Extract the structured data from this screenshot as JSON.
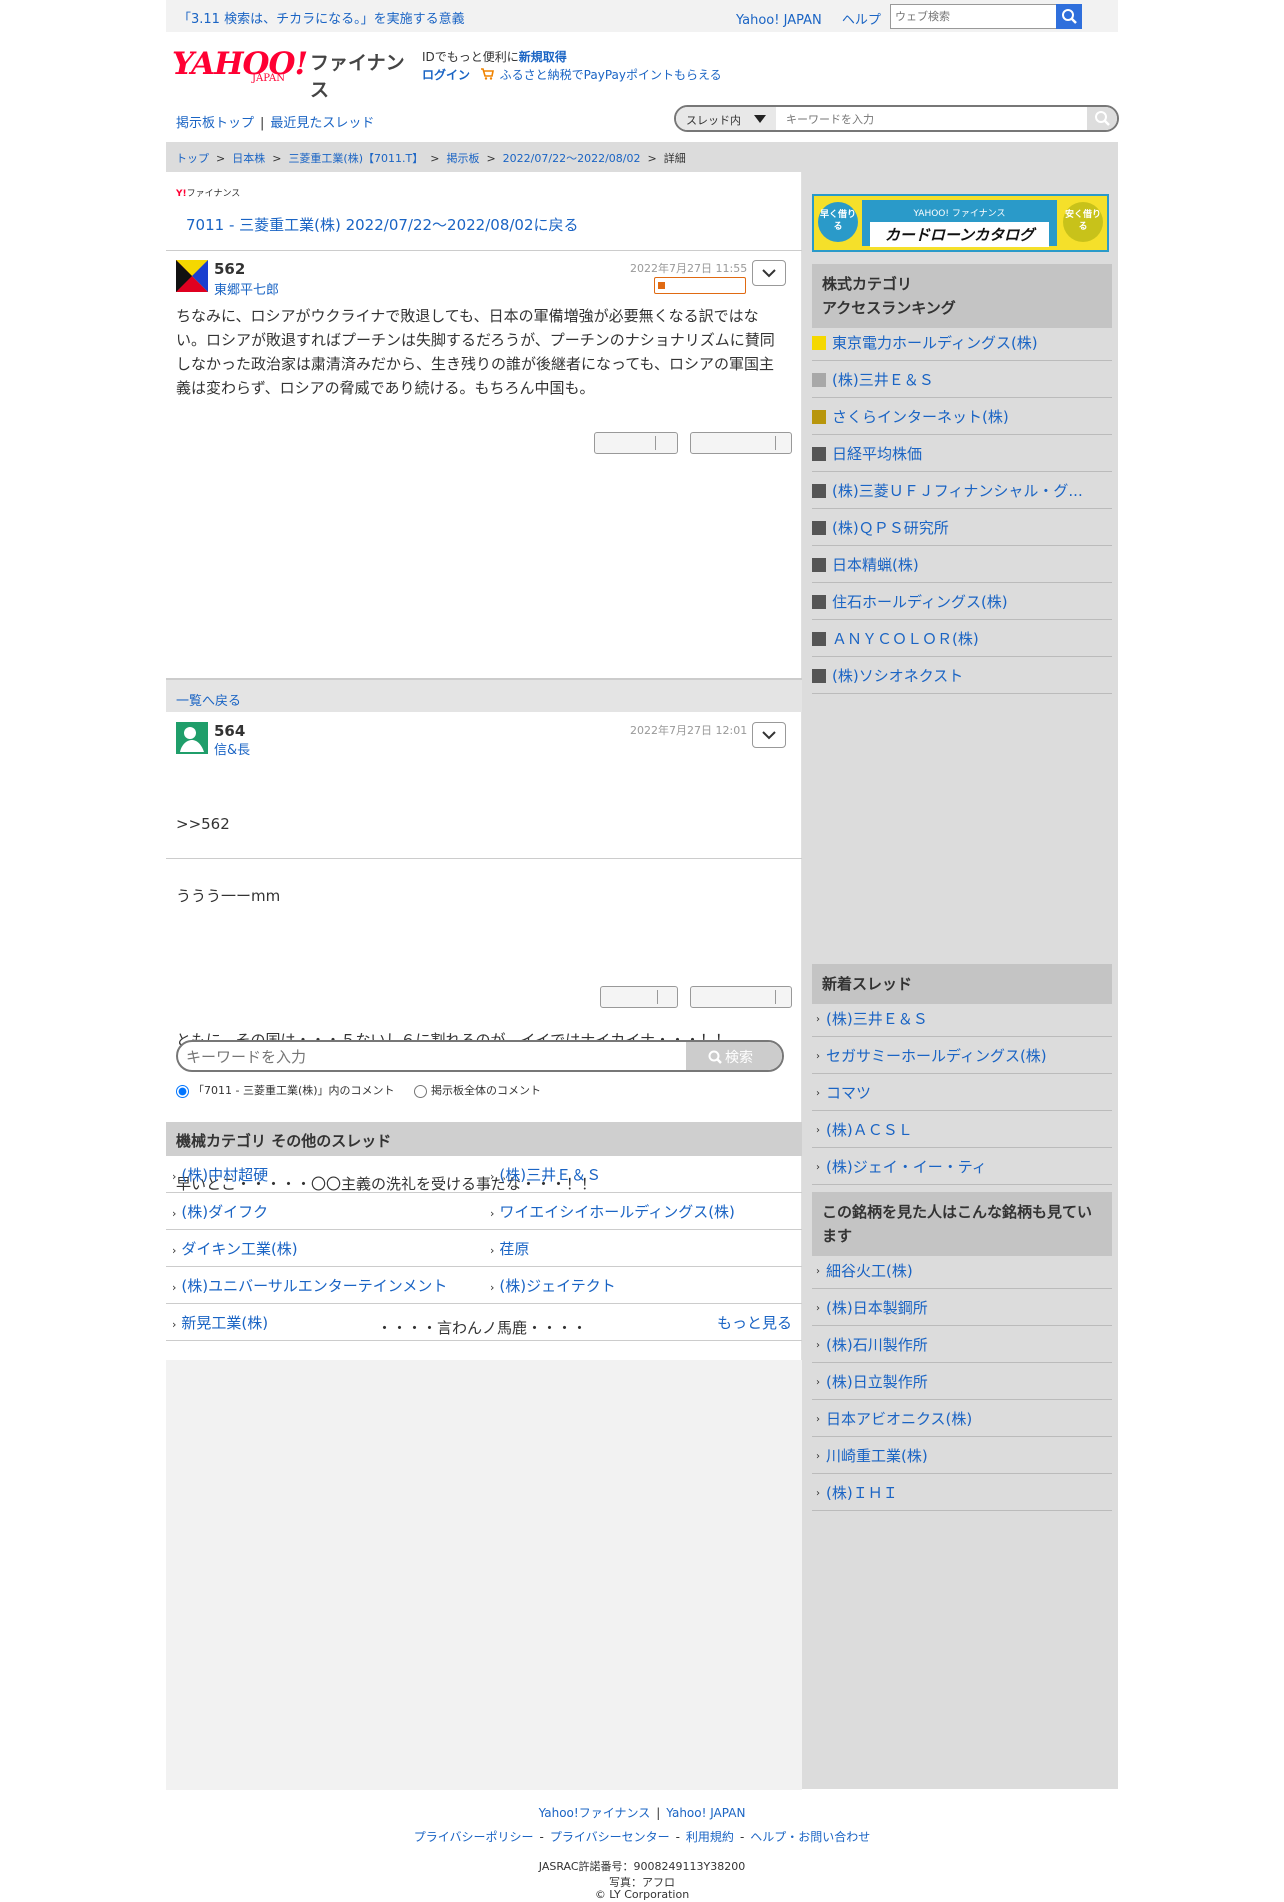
{
  "topbar": {
    "notice": "「3.11 検索は、チカラになる。」を実施する意義",
    "links": [
      "Yahoo! JAPAN",
      "ヘルプ"
    ],
    "search_placeholder": "ウェブ検索"
  },
  "header": {
    "logo_main": "YAHOO!",
    "logo_sub": "JAPAN",
    "logo_service": "ファイナンス",
    "id_line_prefix": "IDでもっと便利に",
    "id_line_link": "新規取得",
    "login": "ログイン",
    "furusato": "ふるさと納税でPayPayポイントもらえる"
  },
  "subnav": {
    "items": [
      "掲示板トップ",
      "最近見たスレッド"
    ],
    "sep": "|",
    "scope": "スレッド内",
    "search_placeholder": "キーワードを入力"
  },
  "breadcrumb": {
    "items": [
      "トップ",
      "日本株",
      "三菱重工業(株)【7011.T】",
      "掲示板",
      "2022/07/22〜2022/08/02"
    ],
    "current": "詳細",
    "sep": ">"
  },
  "thread": {
    "brand_prefix": "Y!",
    "brand_name": "ファイナンス",
    "back_link": "7011 - 三菱重工業(株) 2022/07/22〜2022/08/02に戻る"
  },
  "posts": [
    {
      "num": "562",
      "author": "東郷平七郎",
      "date": "2022年7月27日 11:55",
      "body": "ちなみに、ロシアがウクライナで敗退しても、日本の軍備増強が必要無くなる訳ではない。ロシアが敗退すればプーチンは失脚するだろうが、プーチンのナショナリズムに賛同しなかった政治家は粛清済みだから、生き残りの誰が後継者になっても、ロシアの軍国主義は変わらず、ロシアの脅威であり続ける。もちろん中国も。"
    },
    {
      "num": "564",
      "author": "信&長",
      "date": "2022年7月27日 12:01",
      "body_lines": [
        ">>562",
        "ううう一ーmm",
        "",
        "ともに、その国は・・・５ないし６に割れるのが、イイではナイカイナ・・・！！",
        "",
        "早いとこ・・・・・〇〇主義の洗礼を受ける事だな・・・！！",
        "",
        "・・・・言わんノ馬鹿・・・・"
      ]
    }
  ],
  "back_to_list": "一覧へ戻る",
  "keyword_search": {
    "placeholder": "キーワードを入力",
    "button": "検索",
    "radio1": "「7011 - 三菱重工業(株)」内のコメント",
    "radio2": "掲示板全体のコメント"
  },
  "other_threads": {
    "title": "機械カテゴリ  その他のスレッド",
    "rows": [
      [
        "(株)中村超硬",
        "(株)三井Ｅ＆Ｓ"
      ],
      [
        "(株)ダイフク",
        "ワイエイシイホールディングス(株)"
      ],
      [
        "ダイキン工業(株)",
        "荏原"
      ],
      [
        "(株)ユニバーサルエンターテインメント",
        "(株)ジェイテクト"
      ]
    ],
    "last": "新晃工業(株)",
    "more": "もっと見る"
  },
  "ad": {
    "left": "早く借りる",
    "top": "YAHOO! ファイナンス",
    "main": "カードローンカタログ",
    "right": "安く借りる"
  },
  "ranking": {
    "title_line1": "株式カテゴリ",
    "title_line2": "アクセスランキング",
    "items": [
      {
        "name": "東京電力ホールディングス(株)",
        "color": "#f5d800"
      },
      {
        "name": "(株)三井Ｅ＆Ｓ",
        "color": "#a8a8a8"
      },
      {
        "name": "さくらインターネット(株)",
        "color": "#b8960c"
      },
      {
        "name": "日経平均株価",
        "color": "#555555"
      },
      {
        "name": "(株)三菱ＵＦＪフィナンシャル・グ...",
        "color": "#555555"
      },
      {
        "name": "(株)ＱＰＳ研究所",
        "color": "#555555"
      },
      {
        "name": "日本精蝋(株)",
        "color": "#555555"
      },
      {
        "name": "住石ホールディングス(株)",
        "color": "#555555"
      },
      {
        "name": "ＡＮＹＣＯＬＯＲ(株)",
        "color": "#555555"
      },
      {
        "name": "(株)ソシオネクスト",
        "color": "#555555"
      }
    ]
  },
  "new_threads": {
    "title": "新着スレッド",
    "items": [
      "(株)三井Ｅ＆Ｓ",
      "セガサミーホールディングス(株)",
      "コマツ",
      "(株)ＡＣＳＬ",
      "(株)ジェイ・イー・ティ"
    ]
  },
  "also_viewed": {
    "title": "この銘柄を見た人はこんな銘柄も見ています",
    "items": [
      "細谷火工(株)",
      "(株)日本製鋼所",
      "(株)石川製作所",
      "(株)日立製作所",
      "日本アビオニクス(株)",
      "川崎重工業(株)",
      "(株)ＩＨＩ"
    ]
  },
  "footer": {
    "links1": [
      "Yahoo!ファイナンス",
      "Yahoo! JAPAN"
    ],
    "links2": [
      "プライバシーポリシー",
      "プライバシーセンター",
      "利用規約",
      "ヘルプ・お問い合わせ"
    ],
    "jasrac": "JASRAC許諾番号：9008249113Y38200",
    "photo": "写真：アフロ",
    "copyright": "© LY Corporation"
  }
}
